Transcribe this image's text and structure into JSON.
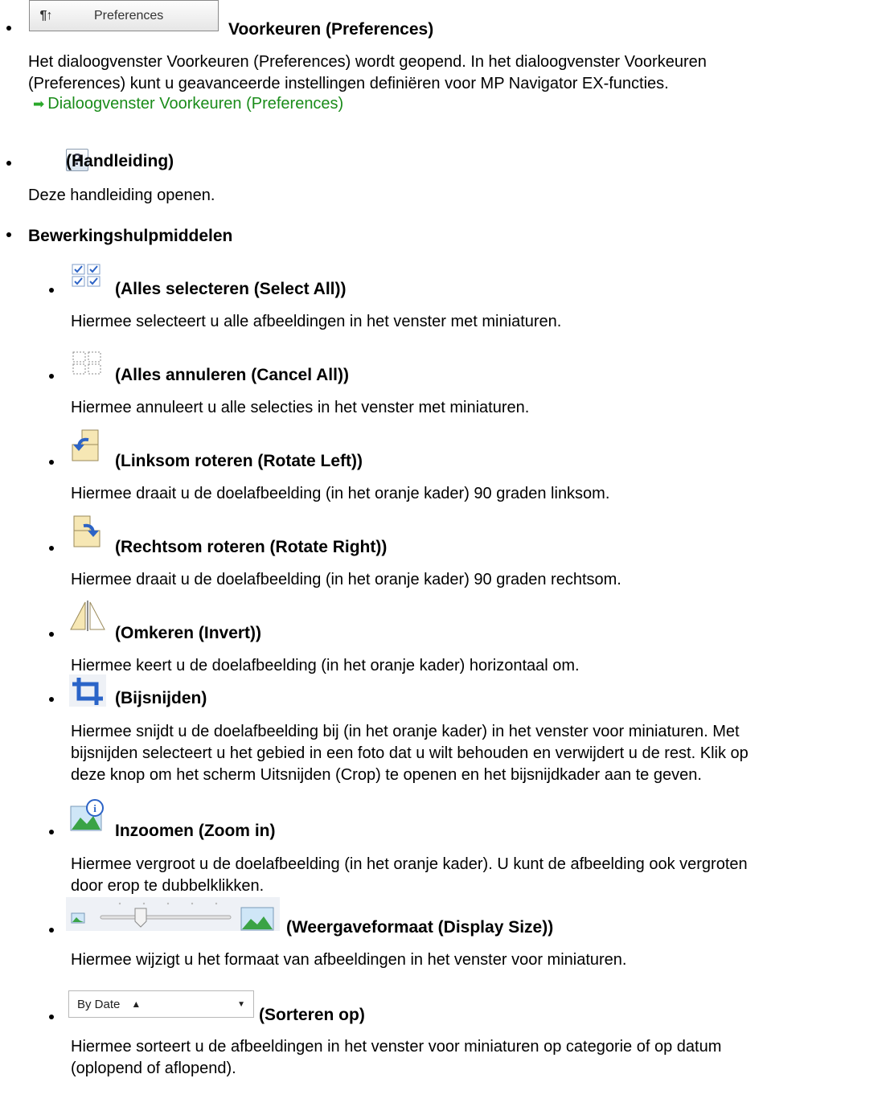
{
  "preferences": {
    "button_label": "Preferences",
    "tool_glyph": "¶↑",
    "heading": "Voorkeuren (Preferences)",
    "paragraph": [
      "Het dialoogvenster Voorkeuren (Preferences) wordt geopend. In het dialoogvenster Voorkeuren",
      "(Preferences) kunt u geavanceerde instellingen definiëren voor MP Navigator EX-functies."
    ],
    "link": "Dialoogvenster Voorkeuren (Preferences)"
  },
  "help": {
    "glyph": "?",
    "heading": "(Handleiding)",
    "paragraph": "Deze handleiding openen."
  },
  "edit_tools": {
    "heading": "Bewerkingshulpmiddelen",
    "items": [
      {
        "heading": "(Alles selecteren (Select All))",
        "lines": [
          "Hiermee selecteert u alle afbeeldingen in het venster met miniaturen."
        ]
      },
      {
        "heading": "(Alles annuleren (Cancel All))",
        "lines": [
          "Hiermee annuleert u alle selecties in het venster met miniaturen."
        ]
      },
      {
        "heading": "(Linksom roteren (Rotate Left))",
        "lines": [
          "Hiermee draait u de doelafbeelding (in het oranje kader) 90 graden linksom."
        ]
      },
      {
        "heading": "(Rechtsom roteren (Rotate Right))",
        "lines": [
          "Hiermee draait u de doelafbeelding (in het oranje kader) 90 graden rechtsom."
        ]
      },
      {
        "heading": "(Omkeren (Invert))",
        "lines": [
          "Hiermee keert u de doelafbeelding (in het oranje kader) horizontaal om."
        ]
      },
      {
        "heading": "(Bijsnijden)",
        "lines": [
          "Hiermee snijdt u de doelafbeelding bij (in het oranje kader) in het venster voor miniaturen. Met",
          "bijsnijden selecteert u het gebied in een foto dat u wilt behouden en verwijdert u de rest. Klik op",
          "deze knop om het scherm Uitsnijden (Crop) te openen en het bijsnijdkader aan te geven."
        ]
      },
      {
        "heading": "Inzoomen (Zoom in)",
        "lines": [
          "Hiermee vergroot u de doelafbeelding (in het oranje kader). U kunt de afbeelding ook vergroten",
          "door erop te dubbelklikken."
        ]
      },
      {
        "heading": "(Weergaveformaat (Display Size))",
        "lines": [
          "Hiermee wijzigt u het formaat van afbeeldingen in het venster voor miniaturen."
        ]
      },
      {
        "heading": "(Sorteren op)",
        "lines": [
          "Hiermee sorteert u de afbeeldingen in het venster voor miniaturen op categorie of op datum",
          "(oplopend of aflopend)."
        ]
      }
    ],
    "sort_control": {
      "value": "By Date",
      "up_glyph": "▲",
      "down_glyph": "▼"
    }
  },
  "colors": {
    "link": "#1a8c1a",
    "arrow": "#2aa82a",
    "icon_blue": "#3a6fc4"
  }
}
